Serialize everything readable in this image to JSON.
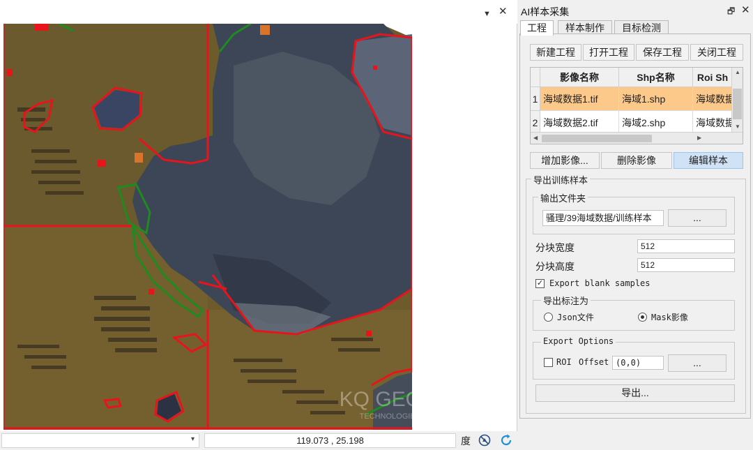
{
  "map_header": {
    "dropdown_icon": "▼",
    "close_icon": "✕"
  },
  "map": {
    "watermark_logo": "KQ GEO",
    "watermark_sub": "TECHNOLOGIES",
    "colors": {
      "water": "#6e5b2c",
      "land": "#3b4453",
      "roi": "#e8141c",
      "green_roi": "#1f7a1f",
      "nodata": "#ffffff"
    }
  },
  "statusbar": {
    "combo_value": "",
    "combo_arrow": "▾",
    "coords": "119.073 , 25.198",
    "unit": "度"
  },
  "panel": {
    "title": "AI样本采集",
    "pin_icon": "🗗",
    "close_icon": "✕",
    "tabs": [
      {
        "label": "工程"
      },
      {
        "label": "样本制作"
      },
      {
        "label": "目标检测"
      }
    ],
    "project_buttons": [
      "新建工程",
      "打开工程",
      "保存工程",
      "关闭工程"
    ],
    "grid": {
      "columns": [
        "影像名称",
        "Shp名称",
        "Roi Sh"
      ],
      "rows": [
        {
          "n": "1",
          "image": "海域数据1.tif",
          "shp": "海域1.shp",
          "roi": "海域数据"
        },
        {
          "n": "2",
          "image": "海域数据2.tif",
          "shp": "海域2.shp",
          "roi": "海域数据"
        }
      ]
    },
    "image_buttons": [
      "增加影像...",
      "删除影像",
      "编辑样本"
    ],
    "export": {
      "group_label": "导出训练样本",
      "folder_label": "输出文件夹",
      "folder_value": "骚理/39海域数据/训练样本",
      "browse_label": "...",
      "block_width_label": "分块宽度",
      "block_width": "512",
      "block_height_label": "分块高度",
      "block_height": "512",
      "blank_samples_label": "Export blank samples",
      "blank_samples_checked": true,
      "annot_label": "导出标注为",
      "json_label": "Json文件",
      "mask_label": "Mask影像",
      "annot_selected": "mask",
      "options_label": "Export Options",
      "roi_label": "ROI",
      "offset_label": "Offset",
      "offset_value": "(0,0)",
      "options_browse": "...",
      "export_button": "导出..."
    }
  }
}
